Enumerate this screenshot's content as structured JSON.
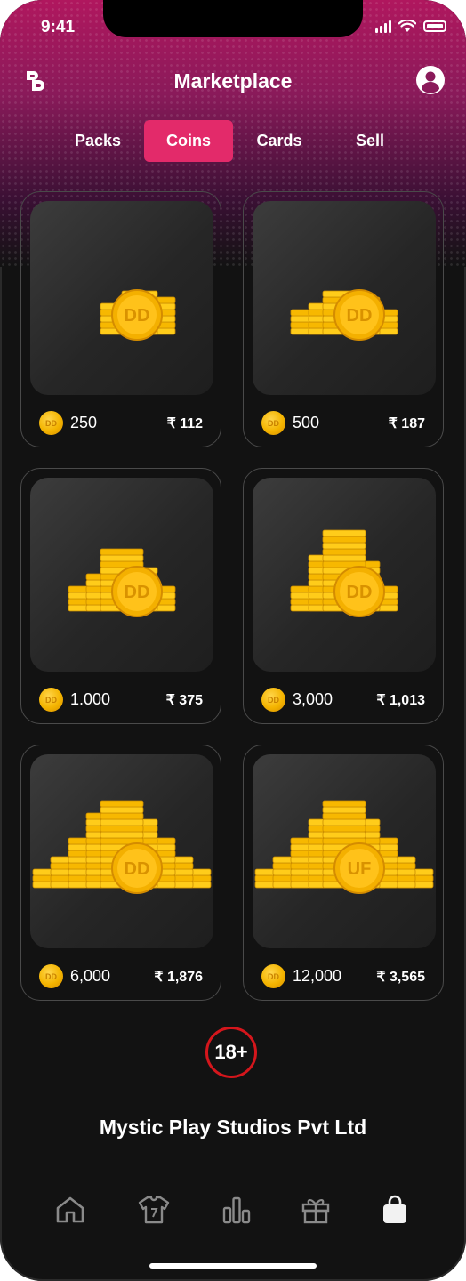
{
  "status": {
    "time": "9:41"
  },
  "header": {
    "title": "Marketplace"
  },
  "tabs": [
    {
      "label": "Packs",
      "active": false
    },
    {
      "label": "Coins",
      "active": true
    },
    {
      "label": "Cards",
      "active": false
    },
    {
      "label": "Sell",
      "active": false
    }
  ],
  "products": [
    {
      "amount": "250",
      "price": "₹ 112",
      "coin_mark": "DD"
    },
    {
      "amount": "500",
      "price": "₹ 187",
      "coin_mark": "DD"
    },
    {
      "amount": "1.000",
      "price": "₹ 375",
      "coin_mark": "DD"
    },
    {
      "amount": "3,000",
      "price": "₹ 1,013",
      "coin_mark": "DD"
    },
    {
      "amount": "6,000",
      "price": "₹ 1,876",
      "coin_mark": "DD"
    },
    {
      "amount": "12,000",
      "price": "₹ 3,565",
      "coin_mark": "UF"
    }
  ],
  "age_badge": "18+",
  "company": "Mystic Play Studios Pvt Ltd",
  "bottom_nav": [
    {
      "icon": "home-icon",
      "active": false
    },
    {
      "icon": "jersey-icon",
      "active": false
    },
    {
      "icon": "leaderboard-icon",
      "active": false
    },
    {
      "icon": "gift-icon",
      "active": false
    },
    {
      "icon": "shopping-bag-icon",
      "active": true
    }
  ],
  "colors": {
    "accent": "#e32a6a",
    "coin": "#f4b400",
    "background": "#121212",
    "age_ring": "#d4161c"
  }
}
